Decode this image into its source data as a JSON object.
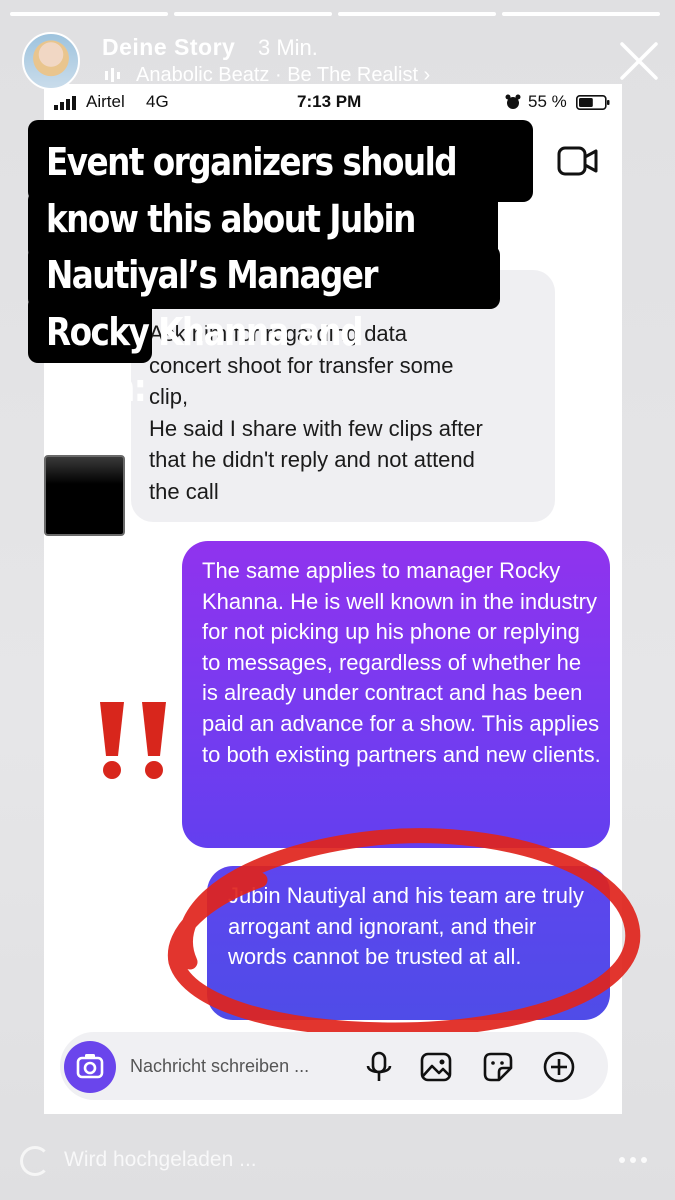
{
  "story": {
    "title": "Deine Story",
    "time": "3 Min.",
    "music": "Anabolic Beatz · Be The Realist ›",
    "progress_segments": 4,
    "segments_done": 4,
    "upload_status": "Wird hochgeladen ..."
  },
  "status_bar": {
    "carrier": "Airtel",
    "network": "4G",
    "time": "7:13 PM",
    "battery": "55 %",
    "battery_level": 0.55
  },
  "caption": "Event organizers should know this about Jubin Nautiyal’s Manager Rocky Khanna and team:",
  "chat": {
    "incoming": "Ask him for regarding data\nconcert shoot for transfer some\nclip,\nHe said I share with few clips after\nthat he didn't reply and not attend\nthe call",
    "outgoing_1": "The same applies to manager Rocky Khanna. He is well known in the industry for not picking up his phone or replying to messages, regardless of whether he is already under contract and has been paid an advance for a show. This applies to both existing partners and new clients.",
    "outgoing_2": "Jubin Nautiyal and his team are truly arrogant and ignorant, and their words cannot be trusted at all."
  },
  "composer": {
    "placeholder": "Nachricht schreiben ..."
  },
  "icons": {
    "close": "close-icon",
    "music": "music-bars-icon",
    "video": "video-camera-icon",
    "camera": "camera-icon",
    "mic": "microphone-icon",
    "gallery": "gallery-icon",
    "sticker": "sticker-icon",
    "add": "plus-circle-icon",
    "more": "more-icon"
  },
  "colors": {
    "bubble_out_top": "#9033ee",
    "bubble_out_bottom": "#4f4ce8",
    "annotation_red": "#e0241c",
    "camera_button": "#6a45ec"
  }
}
